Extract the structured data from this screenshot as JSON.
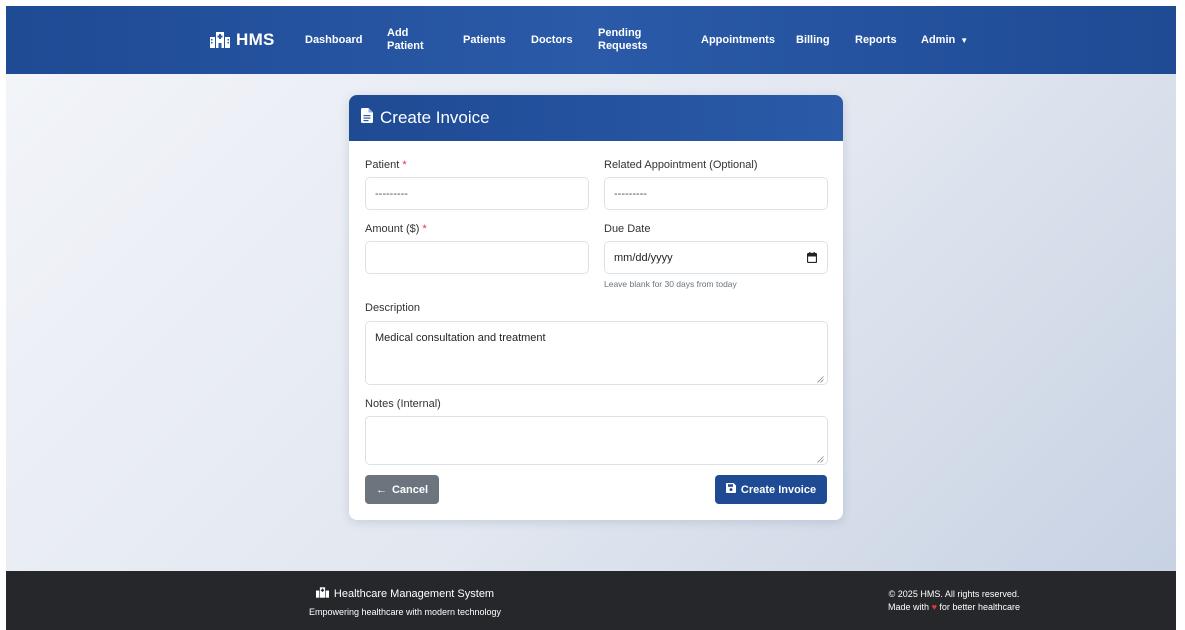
{
  "navbar": {
    "brand": "HMS",
    "items": [
      {
        "label": "Dashboard"
      },
      {
        "label": "Add\nPatient"
      },
      {
        "label": "Patients"
      },
      {
        "label": "Doctors"
      },
      {
        "label": "Pending\nRequests"
      },
      {
        "label": "Appointments"
      },
      {
        "label": "Billing"
      },
      {
        "label": "Reports"
      },
      {
        "label": "Admin"
      }
    ]
  },
  "card": {
    "title": "Create Invoice",
    "patient": {
      "label": "Patient",
      "required_mark": "*",
      "value": "---------"
    },
    "appointment": {
      "label": "Related Appointment (Optional)",
      "value": "---------"
    },
    "amount": {
      "label": "Amount ($)",
      "required_mark": "*",
      "value": ""
    },
    "due_date": {
      "label": "Due Date",
      "placeholder": "mm/dd/yyyy",
      "help": "Leave blank for 30 days from today"
    },
    "description": {
      "label": "Description",
      "value": "Medical consultation and treatment"
    },
    "notes": {
      "label": "Notes (Internal)",
      "value": ""
    },
    "cancel_label": "Cancel",
    "create_label": "Create Invoice"
  },
  "footer": {
    "title": "Healthcare Management System",
    "tagline": "Empowering healthcare with modern technology",
    "copyright": "2025 HMS. All rights reserved.",
    "made_with_prefix": "Made with",
    "made_with_suffix": "for better healthcare"
  },
  "colors": {
    "primary": "#1f4a94",
    "secondary": "#6c757d",
    "required": "#dc3545",
    "footer_bg": "#25272b"
  }
}
